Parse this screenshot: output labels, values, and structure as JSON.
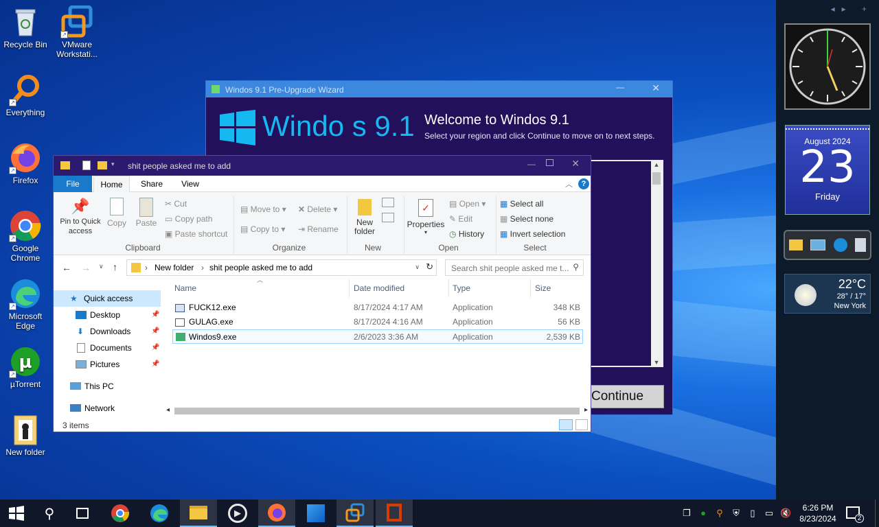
{
  "desktop": {
    "icons": [
      {
        "label": "Recycle Bin",
        "icon": "recycle-bin-icon"
      },
      {
        "label": "VMware Workstati...",
        "icon": "vmware-icon"
      },
      {
        "label": "Everything",
        "icon": "everything-search-icon"
      },
      {
        "label": "Firefox",
        "icon": "firefox-icon"
      },
      {
        "label": "Google Chrome",
        "icon": "chrome-icon"
      },
      {
        "label": "Microsoft Edge",
        "icon": "edge-icon"
      },
      {
        "label": "µTorrent",
        "icon": "utorrent-icon"
      },
      {
        "label": "New folder",
        "icon": "folder-icon"
      }
    ]
  },
  "sidebar": {
    "calendar": {
      "month_year": "August 2024",
      "day": "23",
      "weekday": "Friday"
    },
    "weather": {
      "temp": "22°C",
      "range": "28° / 17°",
      "city": "New York"
    }
  },
  "wizard": {
    "title": "Windos 9.1 Pre-Upgrade Wizard",
    "logo_text": "Windo s 9.1",
    "heading": "Welcome to Windos 9.1",
    "subheading": "Select your region and click Continue to move on to next steps.",
    "continue_label": "Continue"
  },
  "explorer": {
    "title": "shit people asked me to add",
    "tabs": [
      "File",
      "Home",
      "Share",
      "View"
    ],
    "ribbon": {
      "clipboard": {
        "pin": "Pin to Quick access",
        "copy": "Copy",
        "paste": "Paste",
        "cut": "Cut",
        "copy_path": "Copy path",
        "paste_shortcut": "Paste shortcut",
        "group": "Clipboard"
      },
      "organize": {
        "move_to": "Move to",
        "copy_to": "Copy to",
        "delete": "Delete",
        "rename": "Rename",
        "group": "Organize"
      },
      "new": {
        "new_folder": "New folder",
        "group": "New"
      },
      "open": {
        "properties": "Properties",
        "open": "Open",
        "edit": "Edit",
        "history": "History",
        "group": "Open"
      },
      "select": {
        "select_all": "Select all",
        "select_none": "Select none",
        "invert": "Invert selection",
        "group": "Select"
      }
    },
    "breadcrumb": [
      "New folder",
      "shit people asked me to add"
    ],
    "search_placeholder": "Search shit people asked me t...",
    "nav": {
      "quick_access": "Quick access",
      "items": [
        "Desktop",
        "Downloads",
        "Documents",
        "Pictures"
      ],
      "this_pc": "This PC",
      "network": "Network"
    },
    "columns": [
      "Name",
      "Date modified",
      "Type",
      "Size"
    ],
    "files": [
      {
        "name": "FUCK12.exe",
        "date": "8/17/2024 4:17 AM",
        "type": "Application",
        "size": "348 KB"
      },
      {
        "name": "GULAG.exe",
        "date": "8/17/2024 4:16 AM",
        "type": "Application",
        "size": "56 KB"
      },
      {
        "name": "Windos9.exe",
        "date": "2/6/2023 3:36 AM",
        "type": "Application",
        "size": "2,539 KB"
      }
    ],
    "status": "3 items"
  },
  "taskbar": {
    "time": "6:26 PM",
    "date": "8/23/2024",
    "notification_count": "2"
  },
  "colors": {
    "accent": "#1979ca",
    "taskbar": "#101728",
    "wizard_bg": "#22105a"
  }
}
